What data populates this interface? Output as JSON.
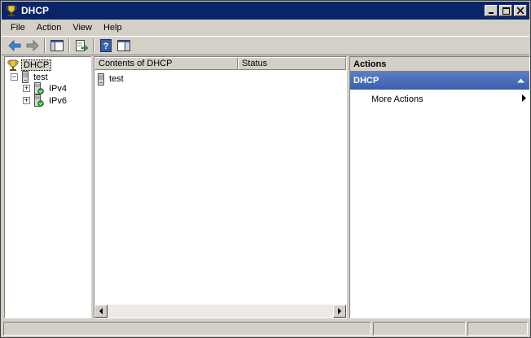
{
  "window": {
    "title": "DHCP",
    "icon": "dhcp-trophy-icon"
  },
  "menu": [
    "File",
    "Action",
    "View",
    "Help"
  ],
  "toolbar": {
    "buttons": [
      "back-arrow-icon",
      "forward-arrow-icon",
      "show-hide-console-tree-icon",
      "export-list-icon",
      "help-icon",
      "show-hide-action-pane-icon"
    ]
  },
  "tree": {
    "root": "DHCP",
    "server": "test",
    "children": [
      "IPv4",
      "IPv6"
    ]
  },
  "list": {
    "columns": [
      "Contents of DHCP",
      "Status"
    ],
    "rows": [
      {
        "name": "test",
        "status": ""
      }
    ]
  },
  "actions": {
    "title": "Actions",
    "group": "DHCP",
    "items": [
      "More Actions"
    ]
  },
  "colors": {
    "titlebar": "#0a246a",
    "actions_header": "#3a5ea8",
    "chrome": "#d4d0c8"
  }
}
